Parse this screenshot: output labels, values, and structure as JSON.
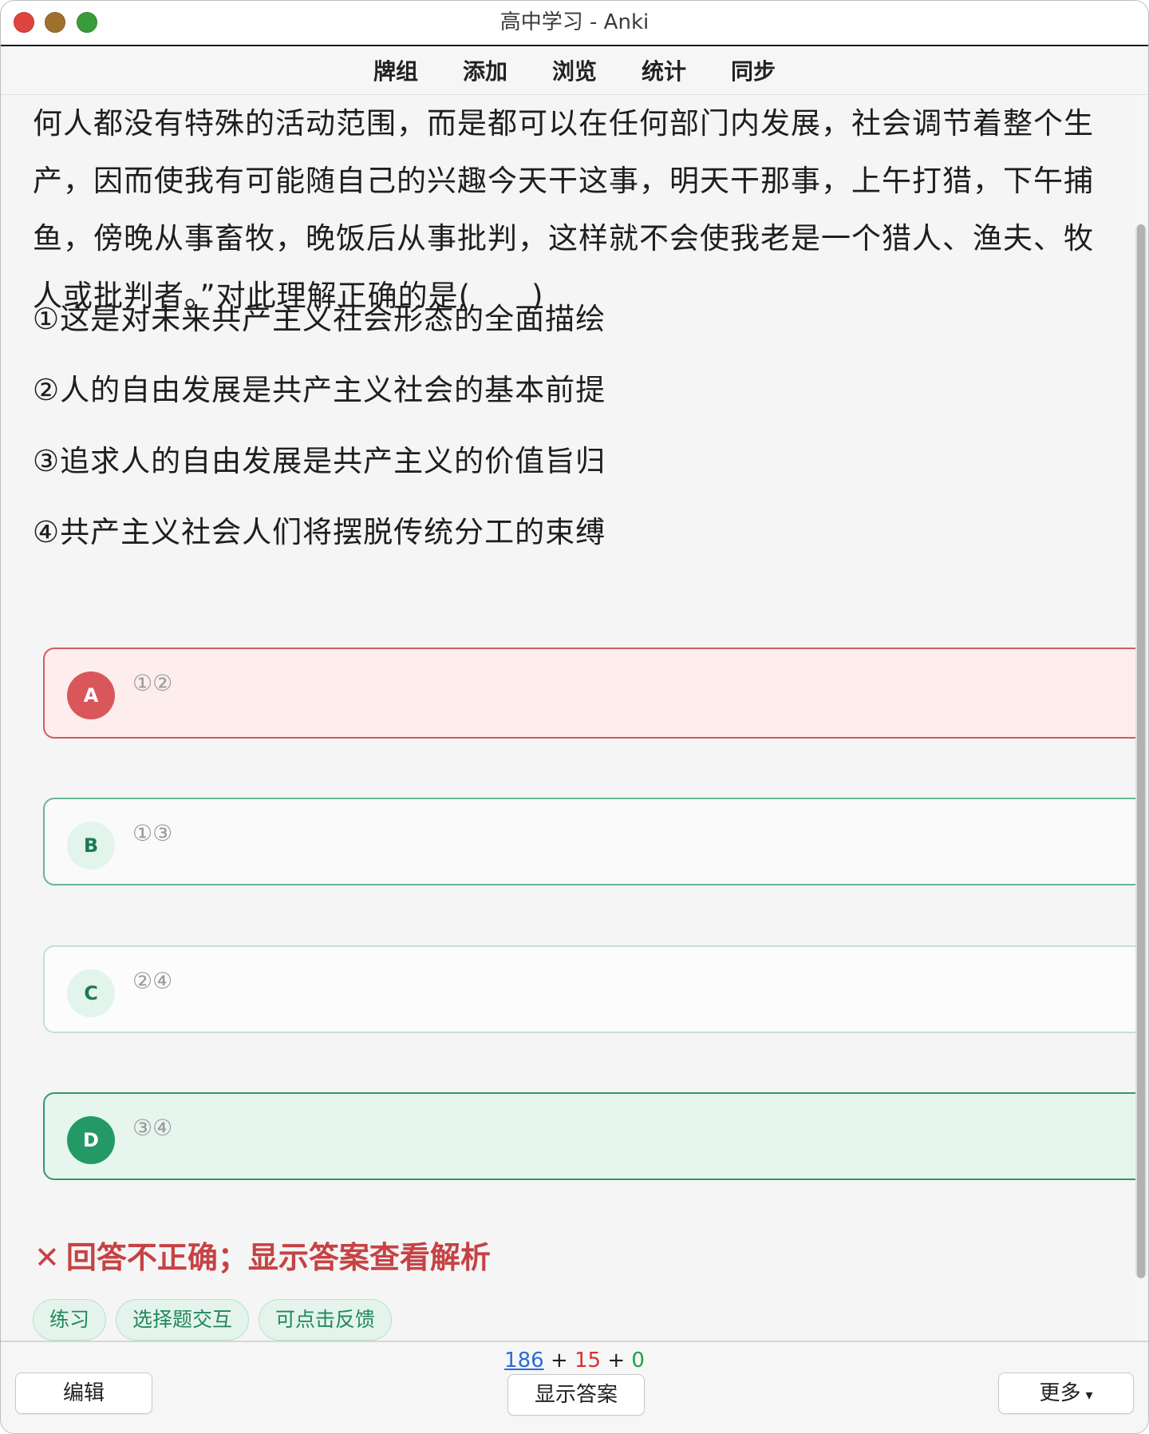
{
  "window": {
    "title": "高中学习 - Anki"
  },
  "toolbar": {
    "items": [
      "牌组",
      "添加",
      "浏览",
      "统计",
      "同步"
    ]
  },
  "question": {
    "lines": [
      "何人都没有特殊的活动范围，而是都可以在任何部门内发展，社会调节着整个生",
      "产，因而使我有可能随自己的兴趣今天干这事，明天干那事，上午打猎，下午捕",
      "鱼，傍晚从事畜牧，晚饭后从事批判，这样就不会使我老是一个猎人、渔夫、牧",
      "人或批判者。”对此理解正确的是(　　)"
    ],
    "statements": [
      "①这是对未来共产主义社会形态的全面描绘",
      "②人的自由发展是共产主义社会的基本前提",
      "③追求人的自由发展是共产主义的价值旨归",
      "④共产主义社会人们将摆脱传统分工的束缚"
    ]
  },
  "options": [
    {
      "letter": "A",
      "text": "①②",
      "state": "wrong-selected"
    },
    {
      "letter": "B",
      "text": "①③",
      "state": "normal"
    },
    {
      "letter": "C",
      "text": "②④",
      "state": "normal"
    },
    {
      "letter": "D",
      "text": "③④",
      "state": "correct"
    }
  ],
  "feedback": {
    "icon": "✕",
    "text": "回答不正确；显示答案查看解析"
  },
  "tags": [
    "练习",
    "选择题交互",
    "可点击反馈"
  ],
  "bottom": {
    "counts": {
      "new": "186",
      "learn": "15",
      "review": "0",
      "sep": "+"
    },
    "edit_label": "编辑",
    "show_answer_label": "显示答案",
    "more_label": "更多"
  },
  "colors": {
    "wrong": "#d9575a",
    "correct": "#239a66",
    "accent_green": "#22875b"
  }
}
